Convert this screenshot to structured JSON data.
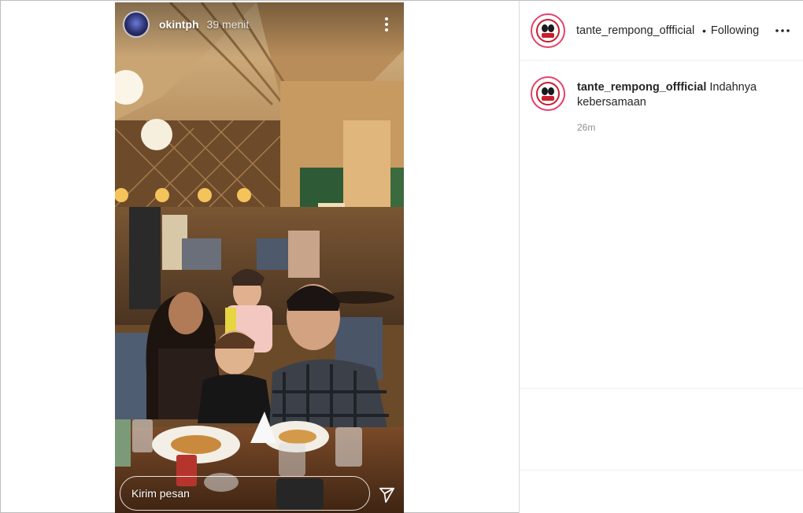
{
  "story": {
    "username": "okintph",
    "time": "39 menit",
    "reply_placeholder": "Kirim pesan",
    "icons": {
      "more": "more-vertical-icon",
      "send": "send-icon"
    }
  },
  "post": {
    "account": "tante_rempong_offficial",
    "follow_status": "Following",
    "caption_user": "tante_rempong_offficial",
    "caption_text": "Indahnya kebersamaan",
    "caption_time": "26m",
    "icons": {
      "more": "more-horizontal-icon"
    }
  },
  "colors": {
    "story_ring": "#e6406b",
    "border": "#dbdbdb",
    "text": "#262626",
    "muted": "#8e8e8e"
  }
}
